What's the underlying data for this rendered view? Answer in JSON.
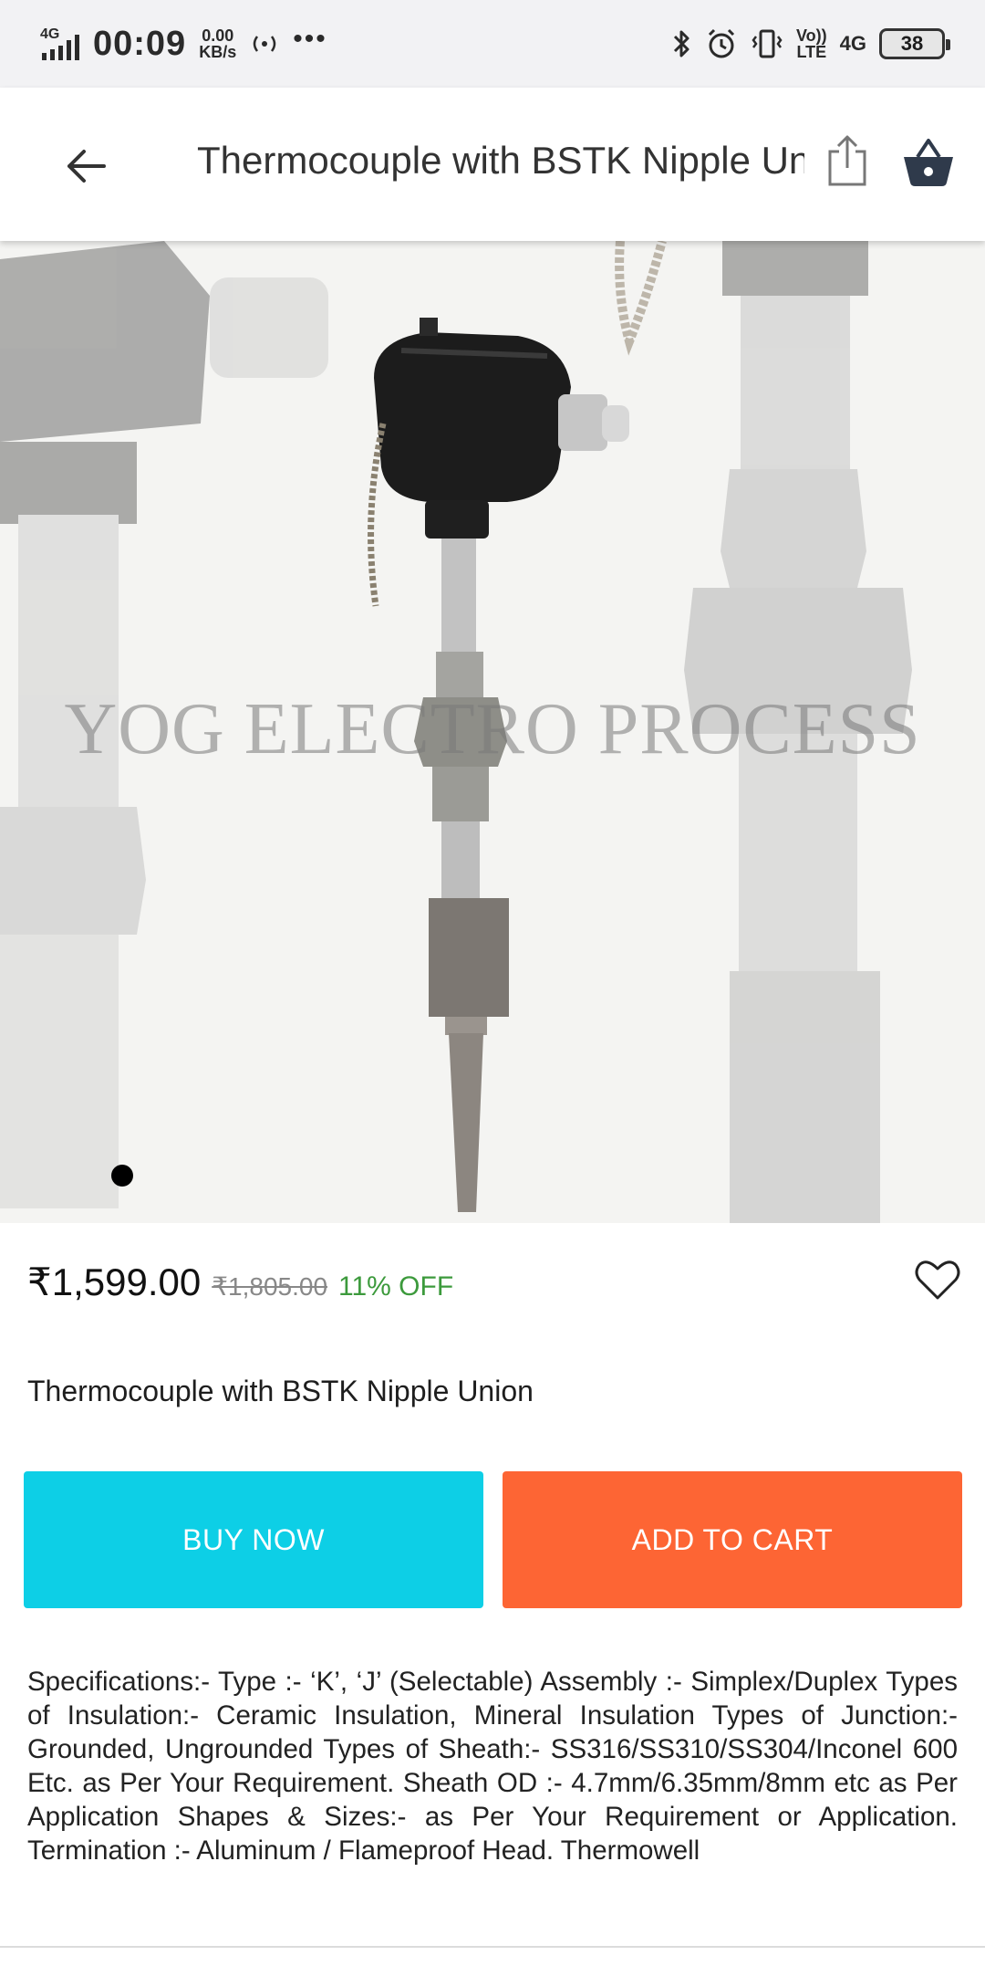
{
  "status_bar": {
    "network": "4G",
    "time": "00:09",
    "speed_value": "0.00",
    "speed_unit": "KB/s",
    "more_dots": "•••",
    "volte_top": "Vo))",
    "volte_bottom": "LTE",
    "network_right": "4G",
    "battery": "38",
    "icons": [
      "signal-icon",
      "hotspot-icon",
      "bluetooth-icon",
      "alarm-icon",
      "vibrate-icon",
      "battery-icon"
    ]
  },
  "app_bar": {
    "title": "Thermocouple with BSTK Nipple Union",
    "icons": [
      "back-arrow-icon",
      "share-icon",
      "cart-basket-icon"
    ]
  },
  "product_image": {
    "watermark": "YOG ELECTRO PROCESS",
    "carousel_index": 1
  },
  "pricing": {
    "current": "₹1,599.00",
    "original": "₹1,805.00",
    "discount": "11% OFF",
    "discount_color": "#3c9a3c"
  },
  "product": {
    "name": "Thermocouple with BSTK Nipple Union",
    "description": "Specifications:- Type :- ‘K’, ‘J’ (Selectable) Assembly :- Simplex/Duplex Types of Insulation:- Ceramic Insulation, Mineral Insulation Types of Junction:- Grounded, Ungrounded Types of Sheath:- SS316/SS310/SS304/Inconel 600 Etc. as Per Your Requirement. Sheath OD :- 4.7mm/6.35mm/8mm etc as Per Application Shapes & Sizes:- as Per Your Requirement or Application. Termination :- Aluminum / Flameproof Head. Thermowell"
  },
  "actions": {
    "buy_now": "BUY NOW",
    "add_to_cart": "ADD TO CART",
    "buy_now_color": "#0dcfe6",
    "add_to_cart_color": "#fd6534"
  }
}
